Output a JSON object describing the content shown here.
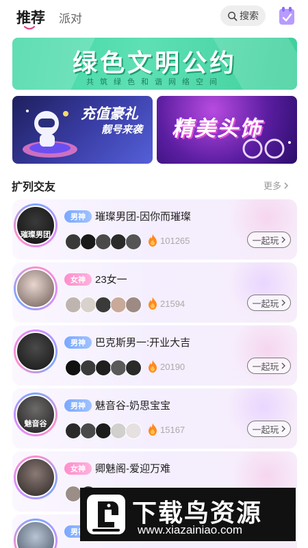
{
  "header": {
    "active_tab": "推荐",
    "inactive_tab": "派对",
    "search_label": "搜索"
  },
  "banner": {
    "title": "绿色文明公约",
    "subtitle": "共筑绿色和谐网络空间"
  },
  "promos": {
    "left_title": "充值豪礼",
    "left_subtitle": "靓号来袭",
    "right_title": "精美头饰"
  },
  "section": {
    "title": "扩列交友",
    "more_label": "更多"
  },
  "rooms": [
    {
      "badge": "男神",
      "badge_type": "male",
      "name": "璀璨男团-因你而璀璨",
      "heat": "101265",
      "join_label": "一起玩",
      "avatar_label": "璀璨男团"
    },
    {
      "badge": "女神",
      "badge_type": "female",
      "name": "23女一",
      "heat": "21594",
      "join_label": "一起玩",
      "avatar_label": ""
    },
    {
      "badge": "男神",
      "badge_type": "male",
      "name": "巴克斯男一:开业大吉",
      "heat": "20190",
      "join_label": "一起玩",
      "avatar_label": ""
    },
    {
      "badge": "男神",
      "badge_type": "male",
      "name": "魅音谷-奶思宝宝",
      "heat": "15167",
      "join_label": "一起玩",
      "avatar_label": "魅音谷"
    },
    {
      "badge": "女神",
      "badge_type": "female",
      "name": "卿魅阁-爱迎万难",
      "heat": "",
      "join_label": "",
      "avatar_label": ""
    },
    {
      "badge": "男神",
      "badge_type": "male",
      "name": "",
      "heat": "",
      "join_label": "",
      "avatar_label": ""
    }
  ],
  "watermark": {
    "title": "下载鸟资源",
    "url": "www.xiazainiao.com"
  },
  "colors": {
    "banner_green": "#3ed6a3",
    "male_badge": "#7aa8ff",
    "female_badge": "#ff8ecb",
    "fire": "#ff8a1f"
  }
}
